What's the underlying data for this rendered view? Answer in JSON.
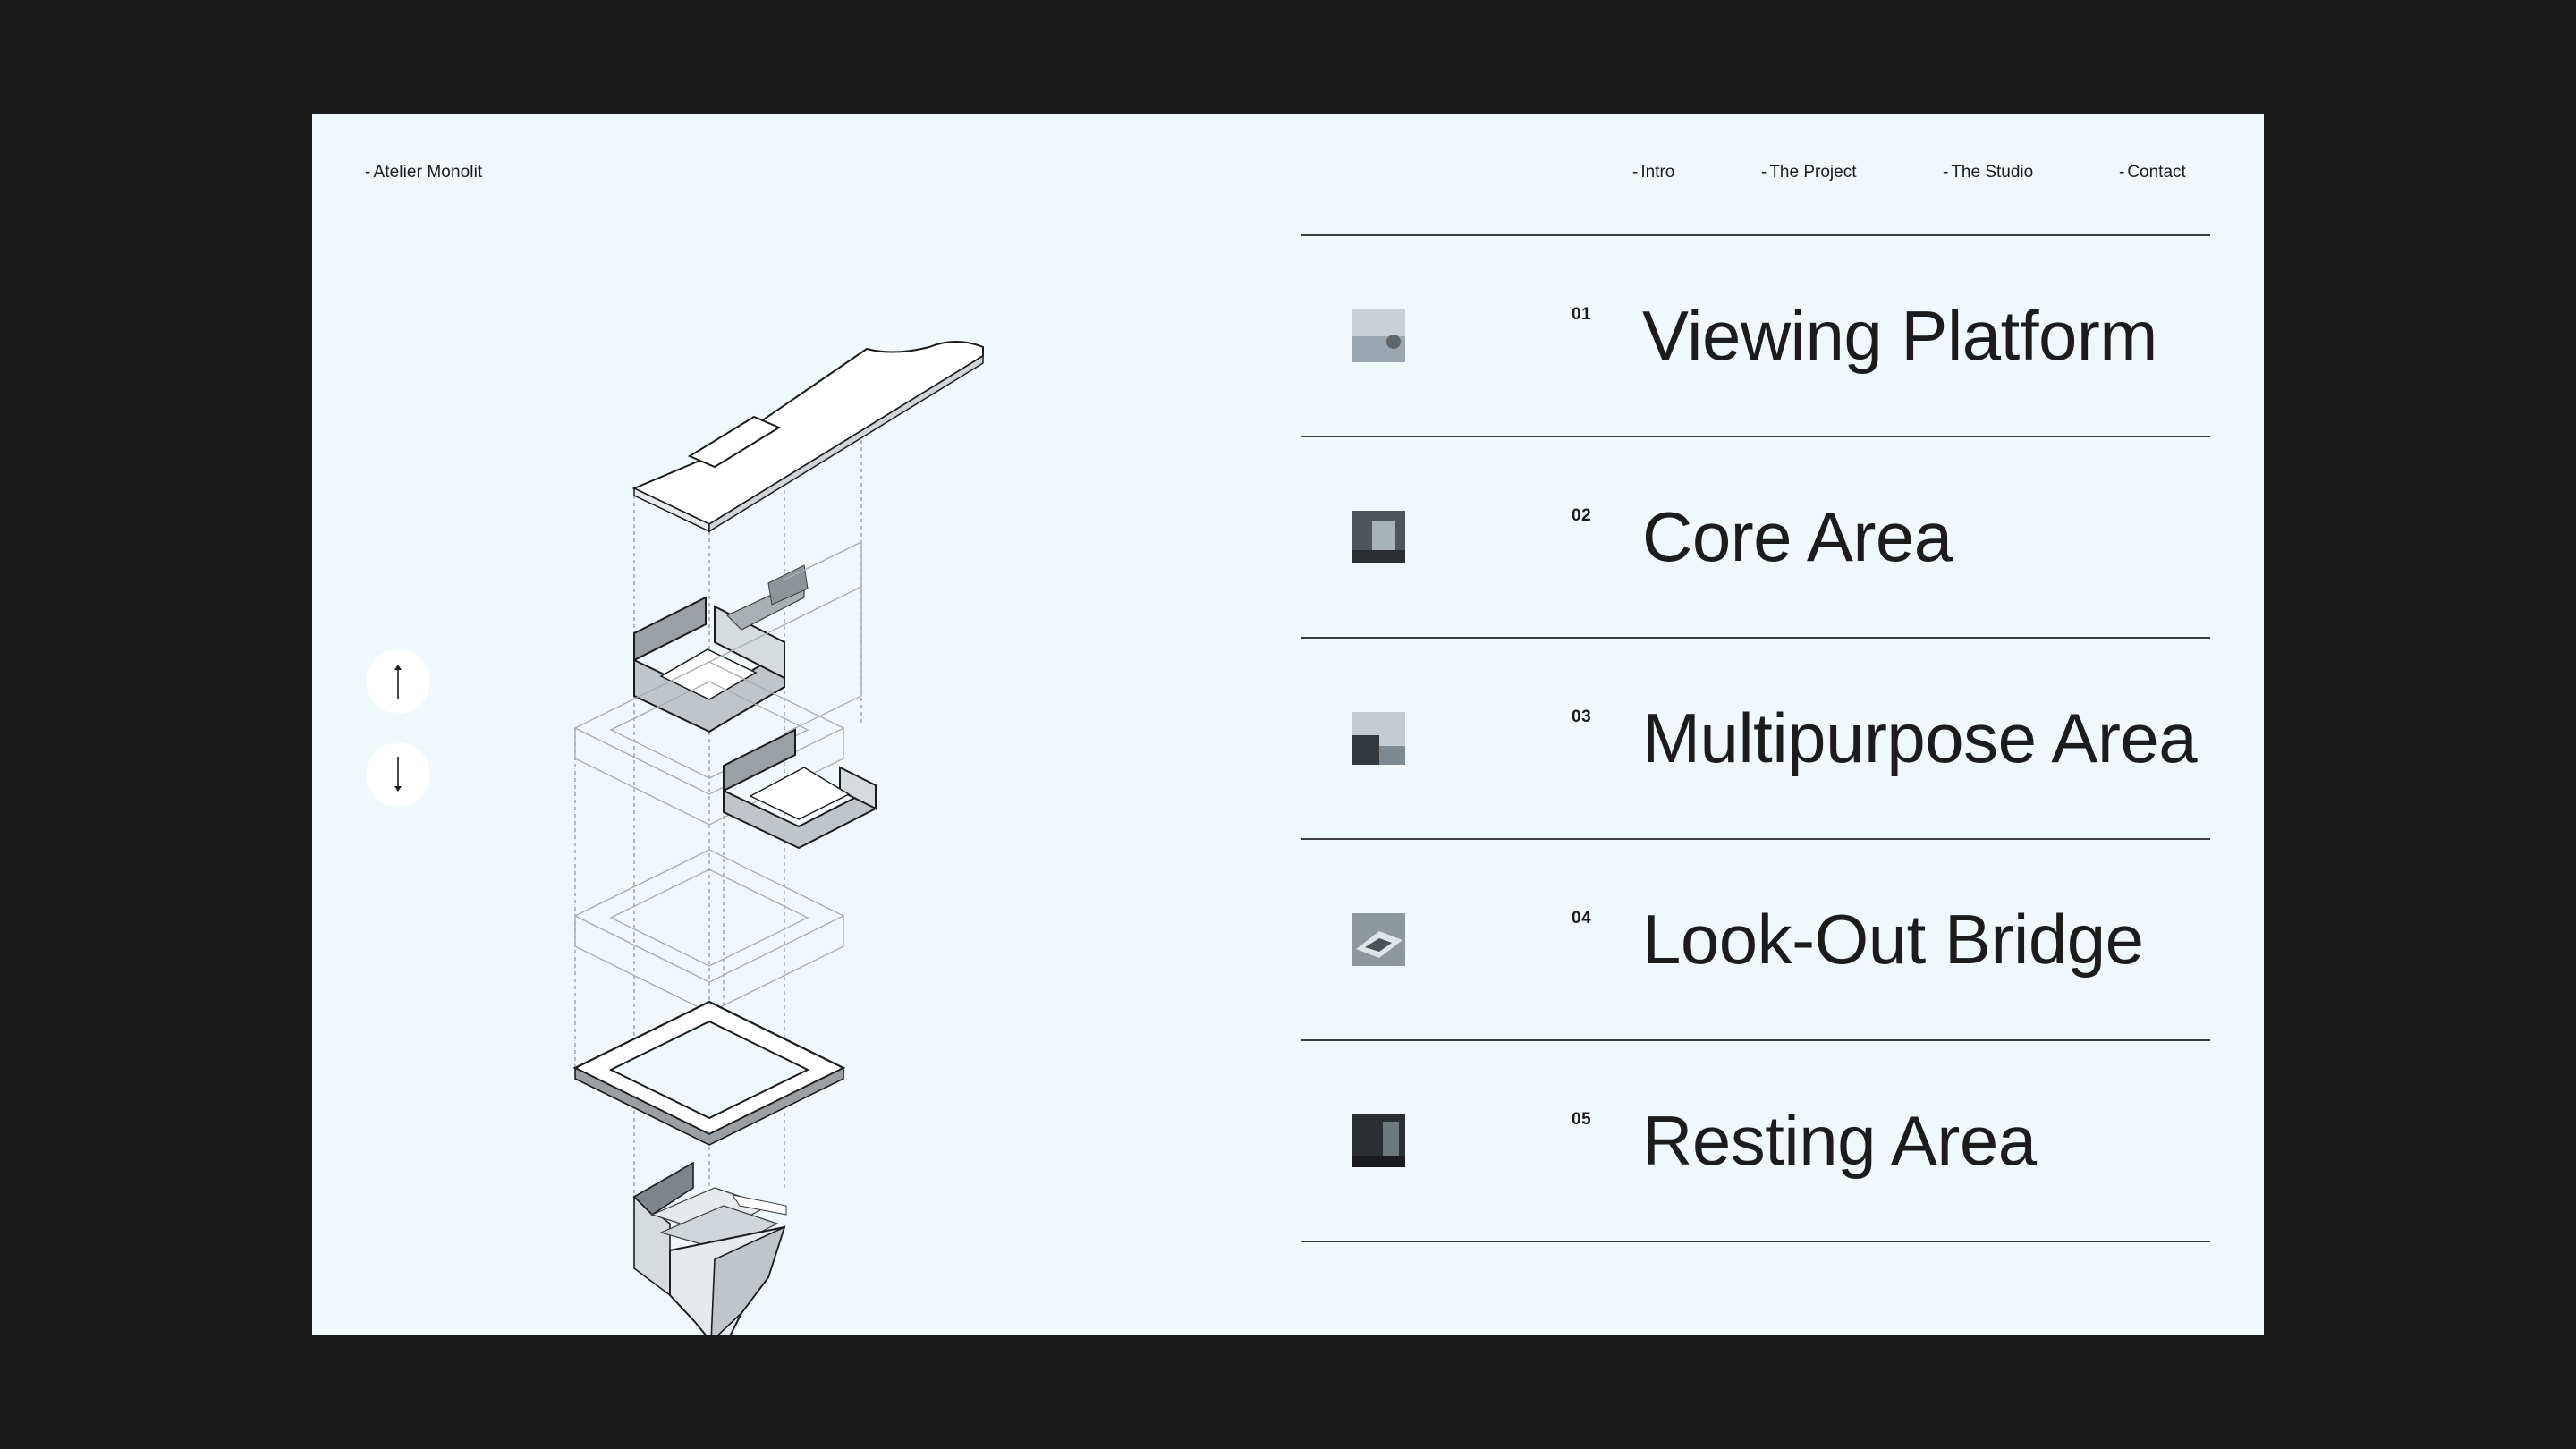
{
  "header": {
    "brand": "Atelier Monolit",
    "nav": [
      "Intro",
      "The Project",
      "The Studio",
      "Contact"
    ]
  },
  "areas": [
    {
      "number": "01",
      "title": "Viewing Platform",
      "thumb_colors": [
        "#9aa7b1",
        "#c9d1d6",
        "#5e666b"
      ]
    },
    {
      "number": "02",
      "title": "Core Area",
      "thumb_colors": [
        "#4f5659",
        "#a8b3b8",
        "#2a2e30"
      ]
    },
    {
      "number": "03",
      "title": "Multipurpose Area",
      "thumb_colors": [
        "#7d8a93",
        "#c4ccd1",
        "#31373a"
      ]
    },
    {
      "number": "04",
      "title": "Look-Out Bridge",
      "thumb_colors": [
        "#8d979c",
        "#dfe4e7",
        "#4a5257"
      ]
    },
    {
      "number": "05",
      "title": "Resting Area",
      "thumb_colors": [
        "#2b2f31",
        "#6e777c",
        "#1a1c1d"
      ]
    }
  ],
  "controls": {
    "up_icon": "arrow-up-icon",
    "down_icon": "arrow-down-icon"
  },
  "colors": {
    "frame": "#1a1a1a",
    "page": "#f1f8fc",
    "text": "#1c1c1c",
    "rule": "#3c3c3c"
  }
}
